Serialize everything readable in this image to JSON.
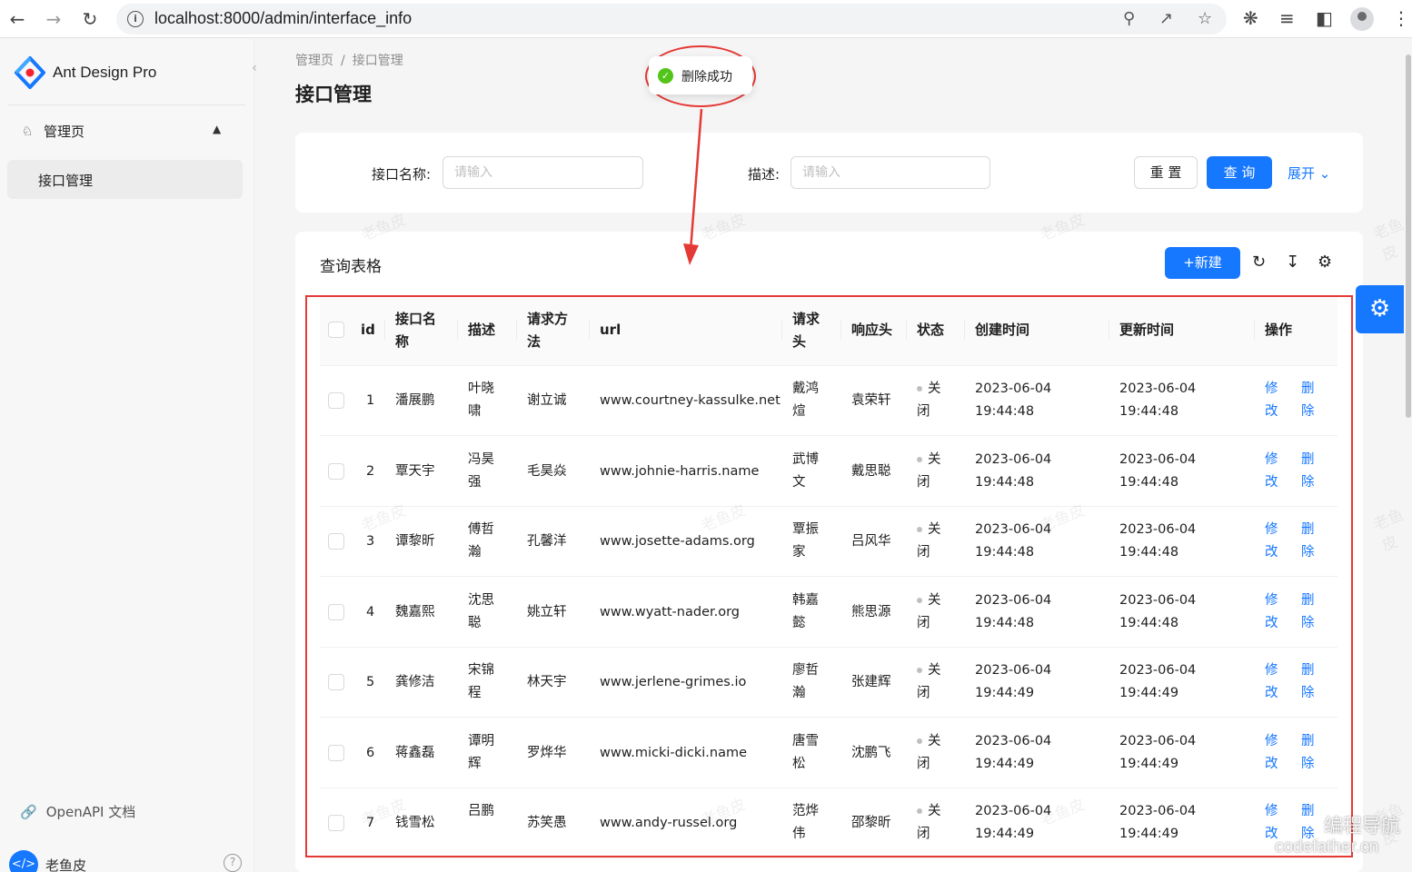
{
  "browser": {
    "url": "localhost:8000/admin/interface_info"
  },
  "sidebar": {
    "brand": "Ant Design Pro",
    "group_label": "管理页",
    "active_item": "接口管理",
    "openapi_link": "OpenAPI 文档",
    "user_name": "老鱼皮"
  },
  "header": {
    "breadcrumb": [
      "管理页",
      "接口管理"
    ],
    "title": "接口管理"
  },
  "toast": {
    "message": "删除成功"
  },
  "search": {
    "name_label": "接口名称:",
    "name_placeholder": "请输入",
    "desc_label": "描述:",
    "desc_placeholder": "请输入",
    "reset_label": "重 置",
    "query_label": "查 询",
    "expand_label": "展开"
  },
  "table": {
    "title": "查询表格",
    "new_label": "+新建",
    "columns": [
      "id",
      "接口名称",
      "描述",
      "请求方法",
      "url",
      "请求头",
      "响应头",
      "状态",
      "创建时间",
      "更新时间",
      "操作"
    ],
    "edit_label": "修改",
    "delete_label": "删除",
    "rows": [
      {
        "id": "1",
        "name": "潘展鹏",
        "desc": "叶晓啸",
        "method": "谢立诚",
        "url": "www.courtney-kassulke.net",
        "req": "戴鸿煊",
        "resp": "袁荣轩",
        "status": "关闭",
        "created": "2023-06-04 19:44:48",
        "updated": "2023-06-04 19:44:48"
      },
      {
        "id": "2",
        "name": "覃天宇",
        "desc": "冯昊强",
        "method": "毛昊焱",
        "url": "www.johnie-harris.name",
        "req": "武博文",
        "resp": "戴思聪",
        "status": "关闭",
        "created": "2023-06-04 19:44:48",
        "updated": "2023-06-04 19:44:48"
      },
      {
        "id": "3",
        "name": "谭黎昕",
        "desc": "傅哲瀚",
        "method": "孔馨洋",
        "url": "www.josette-adams.org",
        "req": "覃振家",
        "resp": "吕风华",
        "status": "关闭",
        "created": "2023-06-04 19:44:48",
        "updated": "2023-06-04 19:44:48"
      },
      {
        "id": "4",
        "name": "魏嘉熙",
        "desc": "沈思聪",
        "method": "姚立轩",
        "url": "www.wyatt-nader.org",
        "req": "韩嘉懿",
        "resp": "熊思源",
        "status": "关闭",
        "created": "2023-06-04 19:44:48",
        "updated": "2023-06-04 19:44:48"
      },
      {
        "id": "5",
        "name": "龚修洁",
        "desc": "宋锦程",
        "method": "林天宇",
        "url": "www.jerlene-grimes.io",
        "req": "廖哲瀚",
        "resp": "张建辉",
        "status": "关闭",
        "created": "2023-06-04 19:44:49",
        "updated": "2023-06-04 19:44:49"
      },
      {
        "id": "6",
        "name": "蒋鑫磊",
        "desc": "谭明辉",
        "method": "罗烨华",
        "url": "www.micki-dicki.name",
        "req": "唐雪松",
        "resp": "沈鹏飞",
        "status": "关闭",
        "created": "2023-06-04 19:44:49",
        "updated": "2023-06-04 19:44:49"
      },
      {
        "id": "7",
        "name": "钱雪松",
        "desc": "吕鹏",
        "method": "苏笑愚",
        "url": "www.andy-russel.org",
        "req": "范烨伟",
        "resp": "邵黎昕",
        "status": "关闭",
        "created": "2023-06-04 19:44:49",
        "updated": "2023-06-04 19:44:49"
      }
    ]
  },
  "watermark": "老鱼皮",
  "corner_watermark": [
    "编程导航",
    "codefather.cn"
  ],
  "icons": {
    "back": "arrow-left-icon",
    "forward": "arrow-right-icon",
    "reload": "reload-icon",
    "info": "info-icon",
    "settings": "gear-icon"
  },
  "colors": {
    "primary": "#1677ff",
    "success": "#52c41a",
    "annotation": "#e53935"
  }
}
